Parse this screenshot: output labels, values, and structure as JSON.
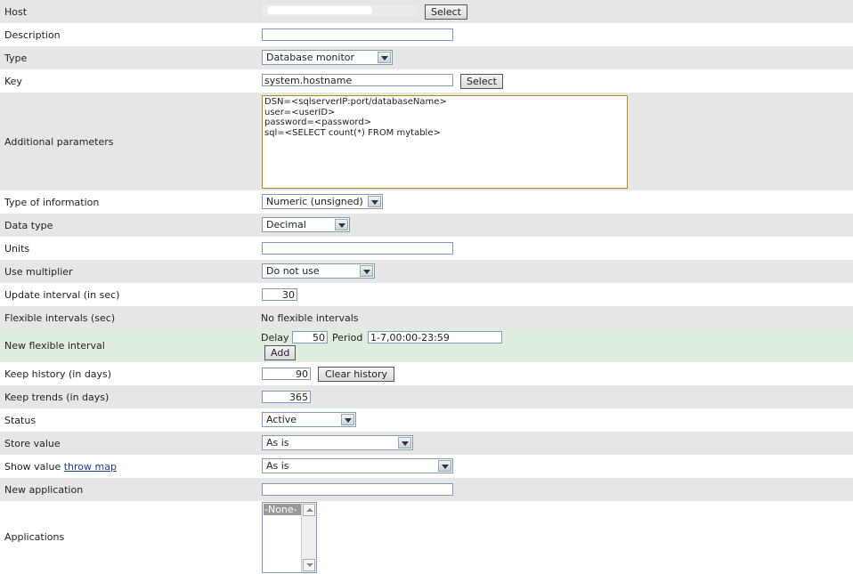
{
  "host": {
    "label": "Host",
    "select_button": "Select"
  },
  "description": {
    "label": "Description",
    "value": ""
  },
  "type": {
    "label": "Type",
    "selected": "Database monitor"
  },
  "key": {
    "label": "Key",
    "value": "system.hostname",
    "select_button": "Select"
  },
  "additional_parameters": {
    "label": "Additional parameters",
    "value": "DSN=<sqlserverIP:port/databaseName>\nuser=<userID>\npassword=<password>\nsql=<SELECT count(*) FROM mytable>"
  },
  "type_of_information": {
    "label": "Type of information",
    "selected": "Numeric (unsigned)"
  },
  "data_type": {
    "label": "Data type",
    "selected": "Decimal"
  },
  "units": {
    "label": "Units",
    "value": ""
  },
  "use_multiplier": {
    "label": "Use multiplier",
    "selected": "Do not use"
  },
  "update_interval": {
    "label": "Update interval (in sec)",
    "value": "30"
  },
  "flexible_intervals": {
    "label": "Flexible intervals (sec)",
    "value": "No flexible intervals"
  },
  "new_flexible_interval": {
    "label": "New flexible interval",
    "delay_label": "Delay",
    "delay_value": "50",
    "period_label": "Period",
    "period_value": "1-7,00:00-23:59",
    "add_button": "Add"
  },
  "keep_history": {
    "label": "Keep history (in days)",
    "value": "90",
    "clear_button": "Clear history"
  },
  "keep_trends": {
    "label": "Keep trends (in days)",
    "value": "365"
  },
  "status": {
    "label": "Status",
    "selected": "Active"
  },
  "store_value": {
    "label": "Store value",
    "selected": "As is"
  },
  "show_value": {
    "label": "Show value",
    "link": "throw map",
    "selected": "As is"
  },
  "new_application": {
    "label": "New application",
    "value": ""
  },
  "applications": {
    "label": "Applications",
    "options": [
      "-None-"
    ]
  },
  "colors": {
    "row_alt": "#e6e6e6",
    "row_green": "#deeddd",
    "link": "#1a3c8c",
    "textarea_border": "#b58b1e"
  }
}
